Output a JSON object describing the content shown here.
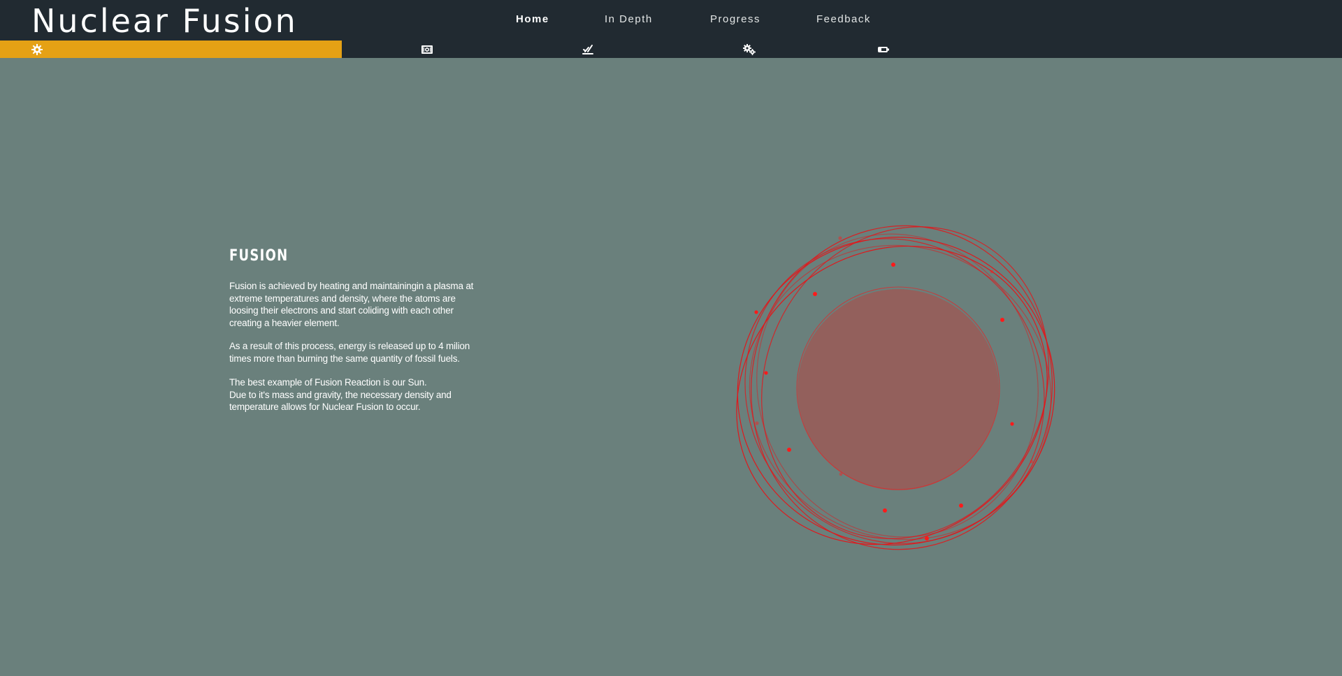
{
  "header": {
    "title": "Nuclear Fusion",
    "nav": [
      {
        "label": "Home",
        "active": true
      },
      {
        "label": "In Depth",
        "active": false
      },
      {
        "label": "Progress",
        "active": false
      },
      {
        "label": "Feedback",
        "active": false
      }
    ],
    "subnav_icons": [
      "sun-gear-icon",
      "reactor-icon",
      "fusion-spark-icon",
      "gears-icon",
      "battery-icon"
    ],
    "accent_color": "#e5a115",
    "bar_color": "#212a31"
  },
  "main": {
    "heading": "FUSION",
    "paragraphs": [
      [
        "Fusion is achieved by heating and maintainingin a plasma at",
        "extreme temperatures and density, where the atoms are",
        "loosing their electrons and start coliding with each other",
        "creating a heavier element."
      ],
      [
        "As a result of this process, energy is released up to 4 milion",
        "times more than burning the same quantity of fossil fuels."
      ],
      [
        "The best example of Fusion Reaction is our Sun.",
        "Due to it's mass and gravity, the necessary density and",
        "temperature allows for Nuclear Fusion to occur."
      ]
    ],
    "background_color": "#6a807c",
    "orbit_color": "#e0181c",
    "core_color": "#93605c"
  }
}
